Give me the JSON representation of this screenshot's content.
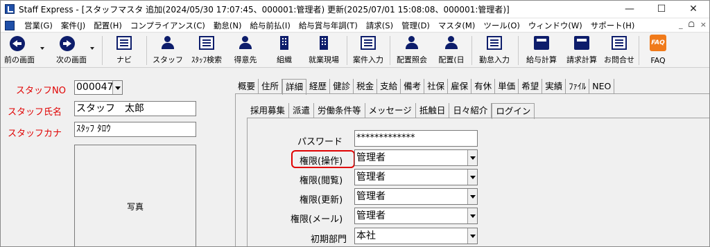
{
  "window": {
    "title": "Staff Express - [スタッフマスタ 追加(2024/05/30 17:07:45、000001:管理者) 更新(2025/07/01 15:08:08、000001:管理者)]",
    "minimize": "—",
    "maximize": "☐",
    "close": "✕"
  },
  "menu": [
    "営業(G)",
    "案件(J)",
    "配置(H)",
    "コンプライアンス(C)",
    "勤怠(N)",
    "給与前払(I)",
    "給与賞与年調(T)",
    "請求(S)",
    "管理(D)",
    "マスタ(M)",
    "ツール(O)",
    "ウィンドウ(W)",
    "サポート(H)"
  ],
  "mdi": {
    "min": "_",
    "restore": "ᗝ",
    "close": "×"
  },
  "toolbar": {
    "back": "前の画面",
    "forward": "次の画面",
    "navi": "ナビ",
    "staff": "スタッフ",
    "staff_search": "ｽﾀｯﾌ検索",
    "client": "得意先",
    "org": "組織",
    "site": "就業現場",
    "job_entry": "案件入力",
    "placement_view": "配置照会",
    "placement_day": "配置(日",
    "attendance": "勤怠入力",
    "payroll": "給与計算",
    "billing": "請求計算",
    "inquiry": "お問合せ",
    "faq": "FAQ",
    "faq_icon_text": "FAQ"
  },
  "left": {
    "staff_no_label": "スタッフNO",
    "staff_no_value": "000047",
    "staff_name_label": "スタッフ氏名",
    "staff_name_value": "スタッフ　太郎",
    "staff_kana_label": "スタッフカナ",
    "staff_kana_value": "ｽﾀｯﾌ ﾀﾛｳ",
    "photo_label": "写真"
  },
  "tabs_main": [
    "概要",
    "住所",
    "詳細",
    "経歴",
    "健診",
    "税金",
    "支給",
    "備考",
    "社保",
    "雇保",
    "有休",
    "単価",
    "希望",
    "実績",
    "ﾌｧｲﾙ",
    "NEO"
  ],
  "tabs_sub": [
    "採用募集",
    "派遣",
    "労働条件等",
    "メッセージ",
    "抵触日",
    "日々紹介",
    "ログイン"
  ],
  "login": {
    "password_label": "パスワード",
    "password_value": "*************",
    "perm_op_label": "権限(操作)",
    "perm_op_value": "管理者",
    "perm_view_label": "権限(閲覧)",
    "perm_view_value": "管理者",
    "perm_update_label": "権限(更新)",
    "perm_update_value": "管理者",
    "perm_mail_label": "権限(メール)",
    "perm_mail_value": "管理者",
    "dept_label": "初期部門",
    "dept_value": "本社"
  }
}
